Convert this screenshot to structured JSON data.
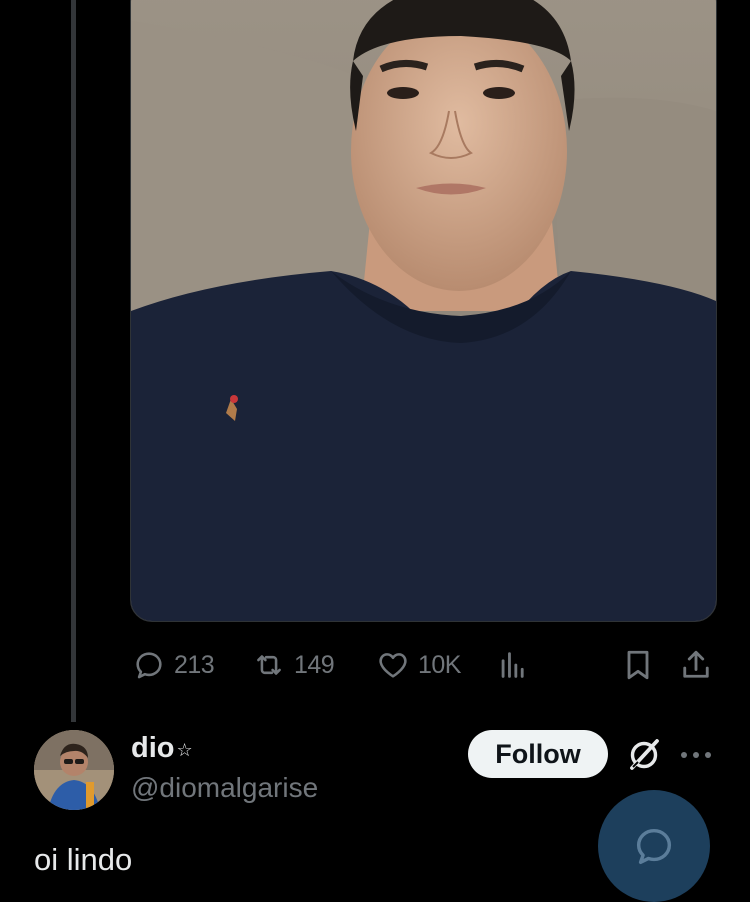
{
  "post": {
    "media_alt": "Selfie photo"
  },
  "actions": {
    "replies": "213",
    "retweets": "149",
    "likes": "10K"
  },
  "reply": {
    "display_name": "dio",
    "name_badge": "☆",
    "handle": "@diomalgarise",
    "follow_label": "Follow",
    "text": "oi lindo"
  },
  "colors": {
    "background": "#000000",
    "muted": "#71767b",
    "text": "#e7e9ea",
    "follow_bg": "#eff3f4",
    "fab_bg": "#1d3f5c"
  },
  "icons": {
    "reply": "speech-bubble-icon",
    "retweet": "retweet-icon",
    "like": "heart-icon",
    "views": "bar-chart-icon",
    "bookmark": "bookmark-icon",
    "share": "share-icon",
    "grok": "grok-icon",
    "more": "more-dots-icon",
    "compose": "compose-reply-icon"
  }
}
